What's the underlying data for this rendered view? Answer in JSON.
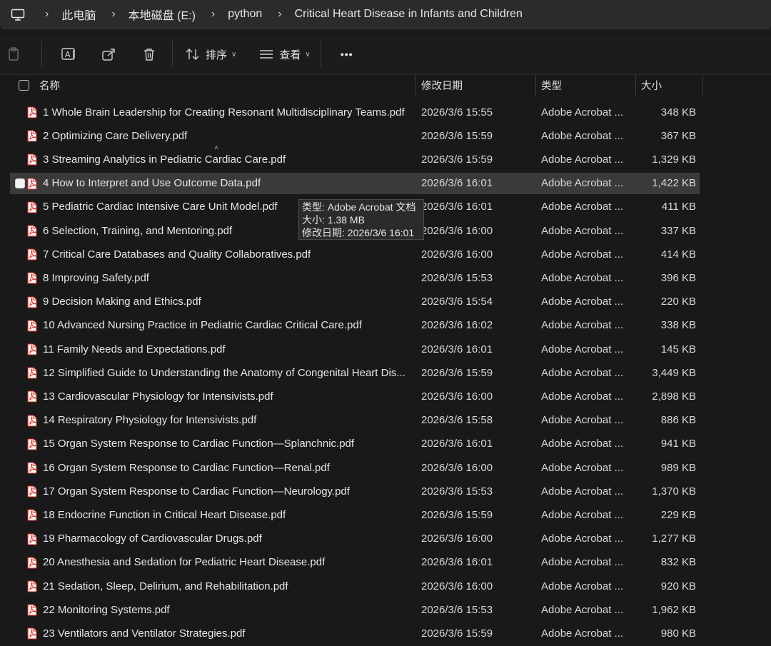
{
  "breadcrumb": {
    "items": [
      "此电脑",
      "本地磁盘 (E:)",
      "python",
      "Critical Heart Disease in Infants and Children"
    ]
  },
  "toolbar": {
    "sort_label": "排序",
    "view_label": "查看",
    "more_label": "•••"
  },
  "columns": {
    "name": "名称",
    "date": "修改日期",
    "type": "类型",
    "size": "大小"
  },
  "files": [
    {
      "name": "1 Whole Brain Leadership for Creating Resonant Multidisciplinary Teams.pdf",
      "date": "2026/3/6 15:55",
      "type": "Adobe Acrobat ...",
      "size": "348 KB"
    },
    {
      "name": "2 Optimizing Care Delivery.pdf",
      "date": "2026/3/6 15:59",
      "type": "Adobe Acrobat ...",
      "size": "367 KB"
    },
    {
      "name": "3 Streaming Analytics in Pediatric Cardiac Care.pdf",
      "date": "2026/3/6 15:59",
      "type": "Adobe Acrobat ...",
      "size": "1,329 KB"
    },
    {
      "name": "4 How to Interpret and Use Outcome Data.pdf",
      "date": "2026/3/6 16:01",
      "type": "Adobe Acrobat ...",
      "size": "1,422 KB"
    },
    {
      "name": "5 Pediatric Cardiac Intensive Care Unit Model.pdf",
      "date": "2026/3/6 16:01",
      "type": "Adobe Acrobat ...",
      "size": "411 KB"
    },
    {
      "name": "6 Selection, Training, and Mentoring.pdf",
      "date": "2026/3/6 16:00",
      "type": "Adobe Acrobat ...",
      "size": "337 KB"
    },
    {
      "name": "7 Critical Care Databases and Quality Collaboratives.pdf",
      "date": "2026/3/6 16:00",
      "type": "Adobe Acrobat ...",
      "size": "414 KB"
    },
    {
      "name": "8 Improving Safety.pdf",
      "date": "2026/3/6 15:53",
      "type": "Adobe Acrobat ...",
      "size": "396 KB"
    },
    {
      "name": "9 Decision Making and Ethics.pdf",
      "date": "2026/3/6 15:54",
      "type": "Adobe Acrobat ...",
      "size": "220 KB"
    },
    {
      "name": "10 Advanced Nursing Practice in Pediatric Cardiac Critical Care.pdf",
      "date": "2026/3/6 16:02",
      "type": "Adobe Acrobat ...",
      "size": "338 KB"
    },
    {
      "name": "11 Family Needs and Expectations.pdf",
      "date": "2026/3/6 16:01",
      "type": "Adobe Acrobat ...",
      "size": "145 KB"
    },
    {
      "name": "12 Simplified Guide to Understanding the Anatomy of Congenital Heart Dis...",
      "date": "2026/3/6 15:59",
      "type": "Adobe Acrobat ...",
      "size": "3,449 KB"
    },
    {
      "name": "13 Cardiovascular Physiology for Intensivists.pdf",
      "date": "2026/3/6 16:00",
      "type": "Adobe Acrobat ...",
      "size": "2,898 KB"
    },
    {
      "name": "14 Respiratory Physiology for Intensivists.pdf",
      "date": "2026/3/6 15:58",
      "type": "Adobe Acrobat ...",
      "size": "886 KB"
    },
    {
      "name": "15 Organ System Response to Cardiac Function—Splanchnic.pdf",
      "date": "2026/3/6 16:01",
      "type": "Adobe Acrobat ...",
      "size": "941 KB"
    },
    {
      "name": "16 Organ System Response to Cardiac Function—Renal.pdf",
      "date": "2026/3/6 16:00",
      "type": "Adobe Acrobat ...",
      "size": "989 KB"
    },
    {
      "name": "17 Organ System Response to Cardiac Function—Neurology.pdf",
      "date": "2026/3/6 15:53",
      "type": "Adobe Acrobat ...",
      "size": "1,370 KB"
    },
    {
      "name": "18 Endocrine Function in Critical Heart Disease.pdf",
      "date": "2026/3/6 15:59",
      "type": "Adobe Acrobat ...",
      "size": "229 KB"
    },
    {
      "name": "19 Pharmacology of Cardiovascular Drugs.pdf",
      "date": "2026/3/6 16:00",
      "type": "Adobe Acrobat ...",
      "size": "1,277 KB"
    },
    {
      "name": "20 Anesthesia and Sedation for Pediatric Heart Disease.pdf",
      "date": "2026/3/6 16:01",
      "type": "Adobe Acrobat ...",
      "size": "832 KB"
    },
    {
      "name": "21 Sedation, Sleep, Delirium, and Rehabilitation.pdf",
      "date": "2026/3/6 16:00",
      "type": "Adobe Acrobat ...",
      "size": "920 KB"
    },
    {
      "name": "22 Monitoring Systems.pdf",
      "date": "2026/3/6 15:53",
      "type": "Adobe Acrobat ...",
      "size": "1,962 KB"
    },
    {
      "name": "23 Ventilators and Ventilator Strategies.pdf",
      "date": "2026/3/6 15:59",
      "type": "Adobe Acrobat ...",
      "size": "980 KB"
    }
  ],
  "tooltip": {
    "type_line": "类型: Adobe Acrobat 文档",
    "size_line": "大小: 1.38 MB",
    "date_line": "修改日期: 2026/3/6 16:01"
  },
  "icons": {
    "pc": "computer-icon",
    "pdf": "pdf-file-icon"
  },
  "colors": {
    "pdf_red": "#d7261e",
    "hover_row": "#3a3a3a"
  }
}
